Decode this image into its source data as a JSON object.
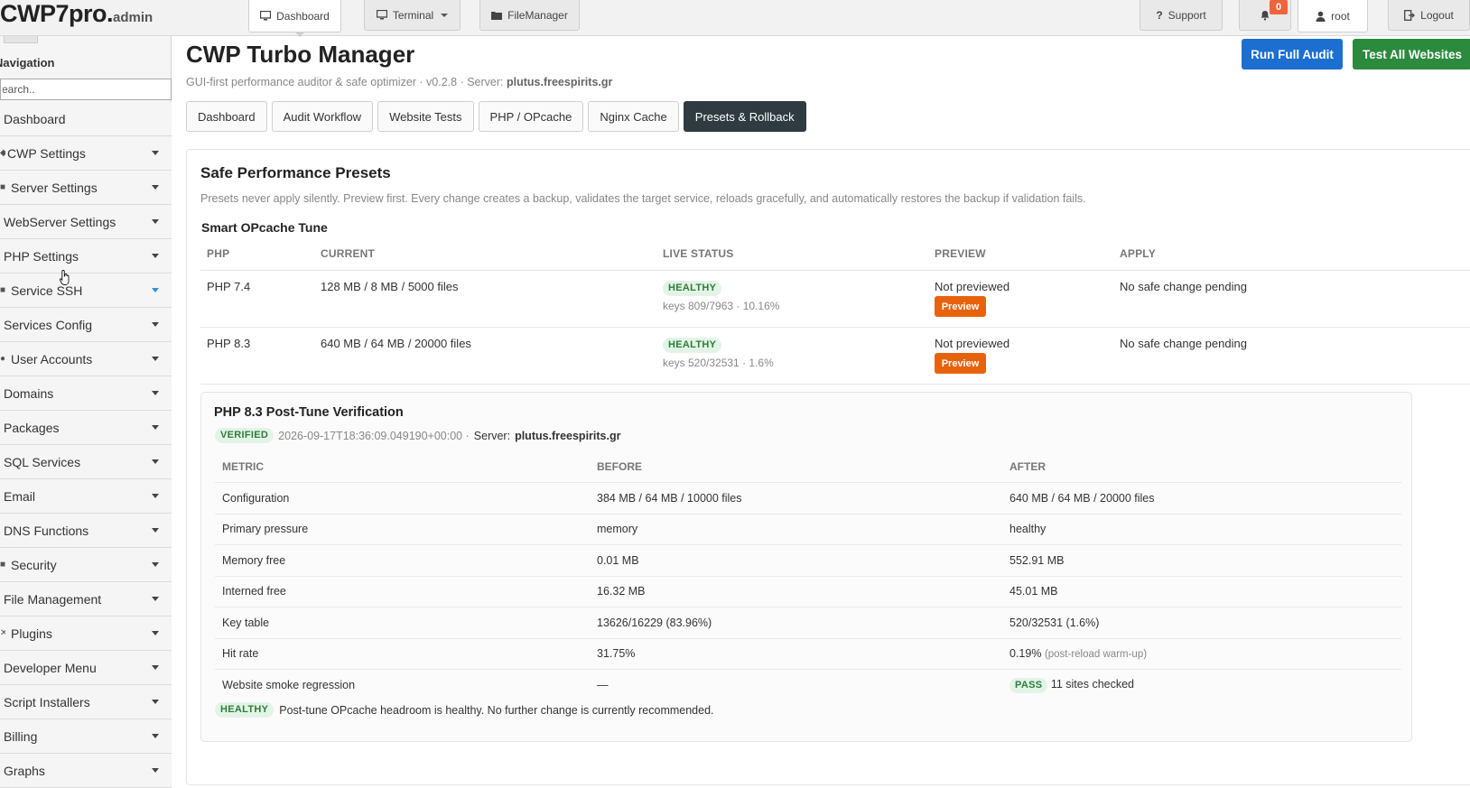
{
  "topbar": {
    "logo_main": "CWP7pro.",
    "logo_sub": "admin",
    "nav": [
      {
        "label": "Dashboard",
        "icon": "monitor-icon"
      },
      {
        "label": "Terminal",
        "icon": "monitor-icon"
      },
      {
        "label": "FileManager",
        "icon": "folder-icon"
      }
    ],
    "support_label": "Support",
    "notifications_count": "0",
    "user_label": "root",
    "logout_label": "Logout"
  },
  "sidebar": {
    "title": "Navigation",
    "search_placeholder": "Search..",
    "items": [
      {
        "label": "Dashboard"
      },
      {
        "label": "CWP Settings"
      },
      {
        "label": "Server Settings"
      },
      {
        "label": "WebServer Settings"
      },
      {
        "label": "PHP Settings"
      },
      {
        "label": "Service SSH"
      },
      {
        "label": "Services Config"
      },
      {
        "label": "User Accounts"
      },
      {
        "label": "Domains"
      },
      {
        "label": "Packages"
      },
      {
        "label": "SQL Services"
      },
      {
        "label": "Email"
      },
      {
        "label": "DNS Functions"
      },
      {
        "label": "Security"
      },
      {
        "label": "File Management"
      },
      {
        "label": "Plugins"
      },
      {
        "label": "Developer Menu"
      },
      {
        "label": "Script Installers"
      },
      {
        "label": "Billing"
      },
      {
        "label": "Graphs"
      }
    ]
  },
  "header": {
    "title": "CWP Turbo Manager",
    "subtitle_prefix": "GUI-first performance auditor & safe optimizer · v0.2.8 · Server: ",
    "server": "plutus.freespirits.gr",
    "run_audit_label": "Run Full Audit",
    "test_websites_label": "Test All Websites"
  },
  "tabs": [
    {
      "label": "Dashboard"
    },
    {
      "label": "Audit Workflow"
    },
    {
      "label": "Website Tests"
    },
    {
      "label": "PHP / OPcache"
    },
    {
      "label": "Nginx Cache"
    },
    {
      "label": "Presets & Rollback"
    }
  ],
  "presets": {
    "title": "Safe Performance Presets",
    "description": "Presets never apply silently. Preview first. Every change creates a backup, validates the target service, reloads gracefully, and automatically restores the backup if validation fails.",
    "section_title": "Smart OPcache Tune",
    "columns": [
      "PHP",
      "CURRENT",
      "LIVE STATUS",
      "PREVIEW",
      "APPLY"
    ],
    "rows": [
      {
        "php": "PHP 7.4",
        "current": "128 MB / 8 MB / 5000 files",
        "status": "HEALTHY",
        "keys": "keys 809/7963 · 10.16%",
        "preview_text": "Not previewed",
        "preview_button": "Preview",
        "apply": "No safe change pending"
      },
      {
        "php": "PHP 8.3",
        "current": "640 MB / 64 MB / 20000 files",
        "status": "HEALTHY",
        "keys": "keys 520/32531 · 1.6%",
        "preview_text": "Not previewed",
        "preview_button": "Preview",
        "apply": "No safe change pending"
      }
    ]
  },
  "verification": {
    "title": "PHP 8.3 Post-Tune Verification",
    "badge": "VERIFIED",
    "timestamp": "2026-09-17T18:36:09.049190+00:00 ·",
    "server_label": "Server:",
    "server": "plutus.freespirits.gr",
    "columns": [
      "METRIC",
      "BEFORE",
      "AFTER"
    ],
    "rows": [
      {
        "metric": "Configuration",
        "before": "384 MB / 64 MB / 10000 files",
        "after": "640 MB / 64 MB / 20000 files",
        "note": "",
        "badge": ""
      },
      {
        "metric": "Primary pressure",
        "before": "memory",
        "after": "healthy",
        "note": "",
        "badge": ""
      },
      {
        "metric": "Memory free",
        "before": "0.01 MB",
        "after": "552.91 MB",
        "note": "",
        "badge": ""
      },
      {
        "metric": "Interned free",
        "before": "16.32 MB",
        "after": "45.01 MB",
        "note": "",
        "badge": ""
      },
      {
        "metric": "Key table",
        "before": "13626/16229 (83.96%)",
        "after": "520/32531 (1.6%)",
        "note": "",
        "badge": ""
      },
      {
        "metric": "Hit rate",
        "before": "31.75%",
        "after": "0.19%",
        "note": "(post-reload warm-up)",
        "badge": ""
      },
      {
        "metric": "Website smoke regression",
        "before": "—",
        "after": "11 sites checked",
        "note": "",
        "badge": "PASS"
      }
    ],
    "footer_badge": "HEALTHY",
    "footer_text": "Post-tune OPcache headroom is healthy. No further change is currently recommended."
  }
}
